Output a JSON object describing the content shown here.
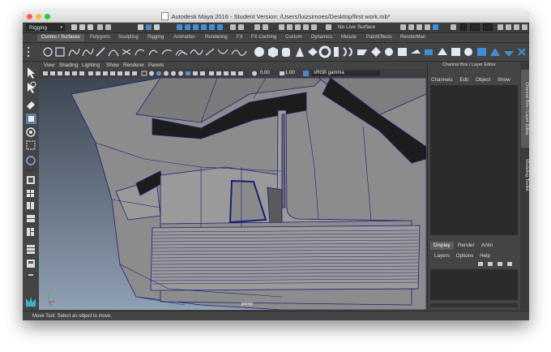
{
  "window": {
    "title": "Autodesk Maya 2016 - Student Version: /Users/luizsimoes/Desktop/first work.mb*"
  },
  "statusline": {
    "mode": "Rigging",
    "live_surface": "No Live Surface",
    "mode_arrow": "▾"
  },
  "shelf_tabs": [
    "Curves / Surfaces",
    "Polygons",
    "Sculpting",
    "Rigging",
    "Animation",
    "Rendering",
    "FX",
    "FX Caching",
    "Custom",
    "Dynamics",
    "Muscle",
    "PaintEffects",
    "RenderMan"
  ],
  "active_shelf": "Curves / Surfaces",
  "panel_menu": [
    "View",
    "Shading",
    "Lighting",
    "Show",
    "Renderer",
    "Panels"
  ],
  "panel_toolbar": {
    "exposure": "0.00",
    "gamma": "1.00",
    "color_space": "sRGB gamma"
  },
  "viewport": {
    "camera": "persp",
    "background_top": "#3d4653",
    "background_bottom": "#8fa0b3",
    "wire_color": "#1d1e7a"
  },
  "channel_box": {
    "header": "Channel Box / Layer Editor",
    "menu": [
      "Channels",
      "Edit",
      "Object",
      "Show"
    ]
  },
  "side_tabs": [
    "Channel Box / Layer Editor",
    "Modeling Toolkit"
  ],
  "layer_tabs": [
    "Display",
    "Render",
    "Anim"
  ],
  "active_layer_tab": "Display",
  "layer_menu": [
    "Layers",
    "Options",
    "Help"
  ],
  "helpline": {
    "text": "Move Tool: Select an object to move."
  },
  "icons": {
    "toolbox": [
      "select-icon",
      "lasso-icon",
      "paint-select-icon",
      "move-icon",
      "rotate-icon",
      "scale-icon",
      "last-tool-icon",
      "single-view-icon",
      "four-view-icon",
      "outliner-icon"
    ]
  }
}
